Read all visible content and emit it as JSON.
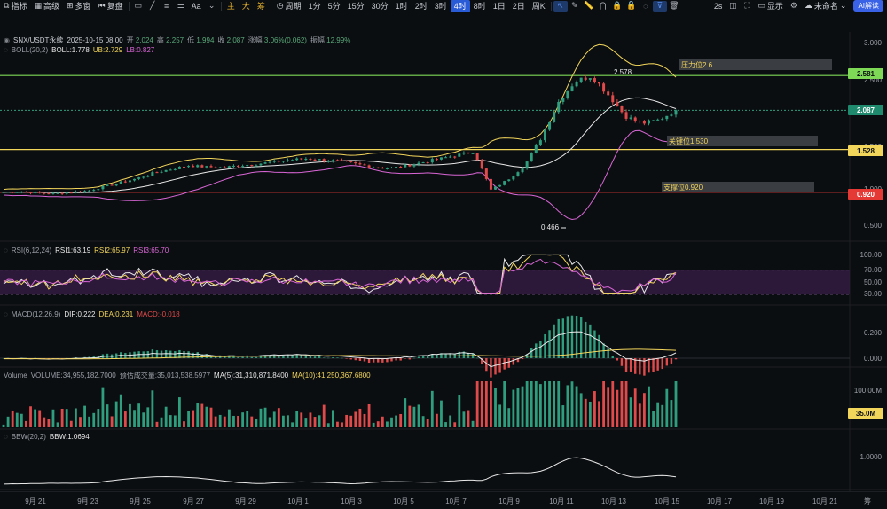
{
  "toolbar": {
    "left": [
      {
        "label": "指标",
        "icon": "chart-indicator-icon"
      },
      {
        "label": "高级",
        "icon": "grid-icon"
      },
      {
        "label": "多窗",
        "icon": "multi-window-icon"
      },
      {
        "label": "复盘",
        "icon": "replay-icon"
      }
    ],
    "tools_icons": [
      "rectangle-icon",
      "line-icon",
      "text-lines-icon",
      "settings-sliders-icon"
    ],
    "font_label": "Aa",
    "chips": [
      "主",
      "大",
      "筹"
    ],
    "period_label": "周期",
    "intervals": [
      "1分",
      "5分",
      "15分",
      "30分",
      "1时",
      "2时",
      "3时",
      "4时",
      "8时",
      "1日",
      "2日",
      "周K"
    ],
    "active_interval": "4时",
    "draw_icons": [
      "cursor-icon",
      "pen-icon",
      "ruler-icon",
      "magnet-icon",
      "lock-icon",
      "unlock-icon",
      "eye-off-icon",
      "filter-icon",
      "trash-icon"
    ],
    "right": {
      "timer": "2s",
      "snapshot_icon": "camera-icon",
      "fullscreen_icon": "fullscreen-icon",
      "display_label": "显示",
      "gear_icon": "gear-icon",
      "cloud_icon": "cloud-icon",
      "name_label": "未命名",
      "ai_label": "AI解读"
    }
  },
  "info": {
    "symbol": "SNX/USDT永续",
    "datetime": "2025-10-15 08:00",
    "open_label": "开",
    "open": "2.024",
    "high_label": "高",
    "high": "2.257",
    "low_label": "低",
    "low": "1.994",
    "close_label": "收",
    "close": "2.087",
    "change_label": "涨幅",
    "change": "3.06%(0.062)",
    "amp_label": "振幅",
    "amp": "12.99%",
    "boll_name": "BOLL(20,2)",
    "boll": "BOLL:1.778",
    "ub": "UB:2.729",
    "lb": "LB:0.827",
    "rsi_name": "RSI(6,12,24)",
    "rsi1": "RSI1:63.19",
    "rsi2": "RSI2:65.97",
    "rsi3": "RSI3:65.70",
    "macd_name": "MACD(12,26,9)",
    "dif": "DIF:0.222",
    "dea": "DEA:0.231",
    "macd": "MACD:-0.018",
    "vol_name": "Volume",
    "volume": "VOLUME:34,955,182.7000",
    "pred": "预估成交量:35,013,538.5977",
    "ma5": "MA(5):31,310,871.8400",
    "ma10": "MA(10):41,250,367.6800",
    "bbw_name": "BBW(20,2)",
    "bbw": "BBW:1.0694"
  },
  "price_axis": [
    "3.000",
    "2.500",
    "1.500",
    "1.000",
    "0.500"
  ],
  "price_tags": {
    "resist": "2.581",
    "current": "2.087",
    "key": "1.528",
    "support": "0.920"
  },
  "annotations": {
    "resist_text": "压力位2.6",
    "key_text": "关键位1.530",
    "support_text": "支撑位0.920",
    "high_mark": "2.578",
    "low_mark": "0.466"
  },
  "rsi_axis": [
    "100.00",
    "70.00",
    "50.00",
    "30.00"
  ],
  "macd_axis": [
    "0.200",
    "0.000"
  ],
  "vol_axis": [
    "100.00M"
  ],
  "vol_tag": "35.0M",
  "bbw_axis": [
    "1.0000"
  ],
  "x_axis": [
    "9月 21",
    "9月 23",
    "9月 25",
    "9月 27",
    "9月 29",
    "10月 1",
    "10月 3",
    "10月 5",
    "10月 7",
    "10月 9",
    "10月 11",
    "10月 13",
    "10月 15",
    "10月 17",
    "10月 19",
    "10月 21"
  ],
  "x_axis_end": "筹",
  "colors": {
    "up": "#2f9e7e",
    "down": "#e04a4a",
    "resist_line": "#7ed957",
    "key_line": "#f2d55b",
    "support_line": "#e53935",
    "current_tag": "#1f8a6d"
  },
  "chart_data": [
    {
      "type": "candlestick",
      "title": "SNX/USDT永续",
      "interval": "4时",
      "price_range": [
        0.4,
        3.05
      ],
      "approx_closes": [
        0.92,
        0.93,
        0.91,
        0.9,
        0.92,
        0.94,
        1.0,
        1.06,
        1.12,
        1.2,
        1.25,
        1.3,
        1.28,
        1.27,
        1.3,
        1.32,
        1.35,
        1.38,
        1.4,
        1.38,
        1.36,
        1.32,
        1.28,
        1.26,
        1.3,
        1.35,
        1.4,
        1.45,
        1.5,
        0.95,
        1.1,
        1.3,
        1.7,
        2.2,
        2.5,
        2.578,
        2.3,
        2.0,
        1.9,
        1.95,
        2.087
      ],
      "last": {
        "open": 2.024,
        "high": 2.257,
        "low": 1.994,
        "close": 2.087
      },
      "levels": {
        "resistance": 2.581,
        "key": 1.528,
        "support": 0.92
      },
      "marked_high": 2.578,
      "marked_low": 0.466
    },
    {
      "type": "line",
      "title": "RSI(6,12,24)",
      "ylim": [
        30,
        100
      ],
      "series": [
        {
          "name": "RSI1",
          "last": 63.19
        },
        {
          "name": "RSI2",
          "last": 65.97
        },
        {
          "name": "RSI3",
          "last": 65.7
        }
      ]
    },
    {
      "type": "bar",
      "title": "MACD(12,26,9)",
      "series": [
        {
          "name": "DIF",
          "last": 0.222
        },
        {
          "name": "DEA",
          "last": 0.231
        },
        {
          "name": "MACD",
          "last": -0.018
        }
      ]
    },
    {
      "type": "bar",
      "title": "Volume",
      "series": [
        {
          "name": "VOLUME",
          "last": 34955182.7
        },
        {
          "name": "MA(5)",
          "last": 31310871.84
        },
        {
          "name": "MA(10)",
          "last": 41250367.68
        }
      ]
    },
    {
      "type": "line",
      "title": "BBW(20,2)",
      "series": [
        {
          "name": "BBW",
          "last": 1.0694
        }
      ]
    }
  ]
}
